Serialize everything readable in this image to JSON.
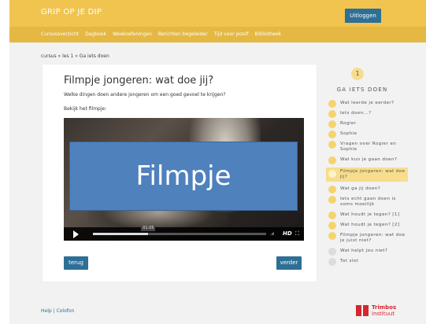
{
  "header": {
    "brand": "GRIP OP JE DIP",
    "logout_label": "Uitloggen"
  },
  "nav": {
    "items": [
      "Cursusoverzicht",
      "Dagboek",
      "Weekoefeningen",
      "Berichten begeleider",
      "Tijd voor jezelf",
      "Bibliotheek"
    ]
  },
  "breadcrumb": "cursus » les 1 » Ga iets doen",
  "main": {
    "title": "Filmpje jongeren: wat doe jij?",
    "intro": "Welke dingen doen andere jongeren om een goed gevoel te krijgen?",
    "watch_prompt": "Bekijk het filmpje:",
    "video": {
      "overlay_label": "Filmpje",
      "time": "01:05",
      "progress": 0.32,
      "hd_label": "HD"
    },
    "back_label": "terug",
    "next_label": "verder"
  },
  "sidebar": {
    "lesson_number": "1",
    "title": "GA IETS DOEN",
    "items": [
      {
        "label": "Wat leerde je eerder?",
        "state": "done"
      },
      {
        "label": "Iets doen...?",
        "state": "done"
      },
      {
        "label": "Rogier",
        "state": "done"
      },
      {
        "label": "Sophie",
        "state": "done"
      },
      {
        "label": "Vragen over Rogier en Sophie",
        "state": "done"
      },
      {
        "label": "Wat kun je gaan doen?",
        "state": "done"
      },
      {
        "label": "Filmpje jongeren: wat doe jij?",
        "state": "active"
      },
      {
        "label": "Wat ga jij doen?",
        "state": "done"
      },
      {
        "label": "Iets echt gaan doen is soms moeilijk",
        "state": "done"
      },
      {
        "label": "Wat houdt je tegen? [1]",
        "state": "done"
      },
      {
        "label": "Wat houdt je tegen? [2]",
        "state": "done"
      },
      {
        "label": "Filmpje jongeren: wat doe je juist niet?",
        "state": "done"
      },
      {
        "label": "Wat helpt jou niet?",
        "state": "todo"
      },
      {
        "label": "Tot slot",
        "state": "todo"
      }
    ]
  },
  "footer": {
    "help": "Help",
    "separator": "|",
    "colofon": "Colofon"
  },
  "logo": {
    "line1": "Trimbos",
    "line2": "instituut"
  },
  "colors": {
    "topbar": "#f0c44f",
    "navbar": "#e4b843",
    "button": "#2e6f95",
    "done_dot": "#f5d46e",
    "active_bg": "#f8dd8c",
    "todo_dot": "#dcdcdc",
    "logo_red": "#d7262f",
    "video_overlay": "#4f81bd"
  }
}
